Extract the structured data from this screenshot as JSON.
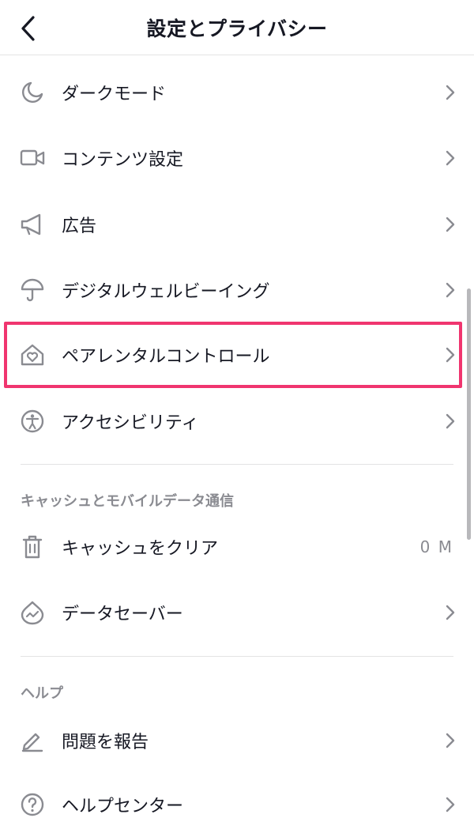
{
  "header": {
    "title": "設定とプライバシー"
  },
  "rows": [
    {
      "label": "ダークモード",
      "icon": "moon-icon"
    },
    {
      "label": "コンテンツ設定",
      "icon": "video-camera-icon"
    },
    {
      "label": "広告",
      "icon": "megaphone-icon"
    },
    {
      "label": "デジタルウェルビーイング",
      "icon": "umbrella-icon"
    },
    {
      "label": "ペアレンタルコントロール",
      "icon": "house-heart-icon"
    },
    {
      "label": "アクセシビリティ",
      "icon": "accessibility-icon"
    }
  ],
  "cache_section": {
    "title": "キャッシュとモバイルデータ通信",
    "clear_cache": {
      "label": "キャッシュをクリア",
      "value": "0 M",
      "icon": "trash-icon"
    },
    "data_saver": {
      "label": "データセーバー",
      "icon": "data-saver-icon"
    }
  },
  "help_section": {
    "title": "ヘルプ",
    "report": {
      "label": "問題を報告",
      "icon": "pencil-icon"
    },
    "help_center": {
      "label": "ヘルプセンター",
      "icon": "question-circle-icon"
    }
  },
  "colors": {
    "highlight": "#f0356f",
    "icon_gray": "#8a8b91",
    "text": "#161823"
  }
}
